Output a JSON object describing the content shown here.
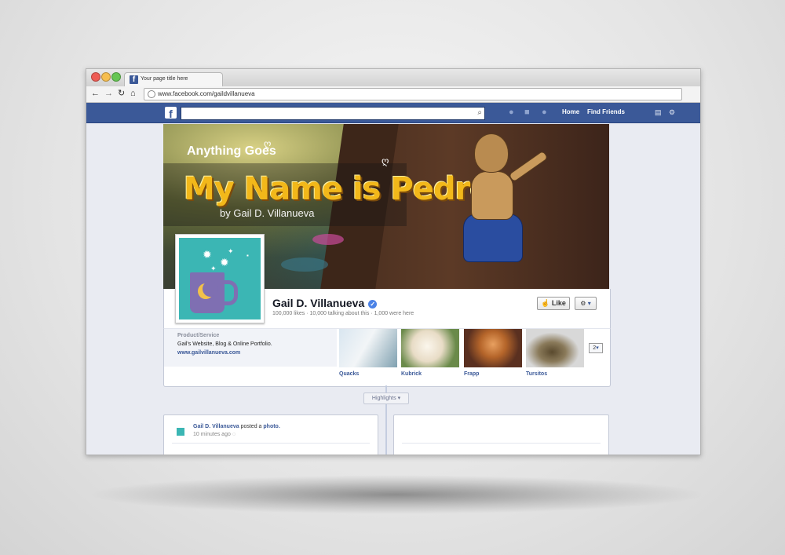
{
  "browser": {
    "tab_title": "Your page title here",
    "url": "www.facebook.com/gaildvillanueva"
  },
  "fb_header": {
    "search_placeholder": "",
    "nav_home": "Home",
    "nav_find_friends": "Find Friends"
  },
  "cover": {
    "subtitle": "Anything Goes",
    "title": "My Name is Pedro",
    "byline": "by Gail D. Villanueva"
  },
  "profile": {
    "name": "Gail D. Villanueva",
    "stats": "100,000 likes · 10,000 talking about this · 1,000 were here",
    "like_label": "Like",
    "category": "Product/Service",
    "description": "Gail's Website, Blog & Online Portfolio.",
    "website": "www.gailvillanueva.com"
  },
  "apps": [
    {
      "label": "Quacks"
    },
    {
      "label": "Kubrick"
    },
    {
      "label": "Frapp"
    },
    {
      "label": "Tursitos"
    }
  ],
  "apps_more": "2",
  "timeline": {
    "highlights_label": "Highlights",
    "post": {
      "author": "Gail D. Villanueva",
      "action": "posted a",
      "object": "photo.",
      "time": "10 minutes ago"
    }
  },
  "colors": {
    "fb_blue": "#3b5998",
    "link_blue": "#3b5998",
    "page_bg": "#e9ebf2"
  }
}
